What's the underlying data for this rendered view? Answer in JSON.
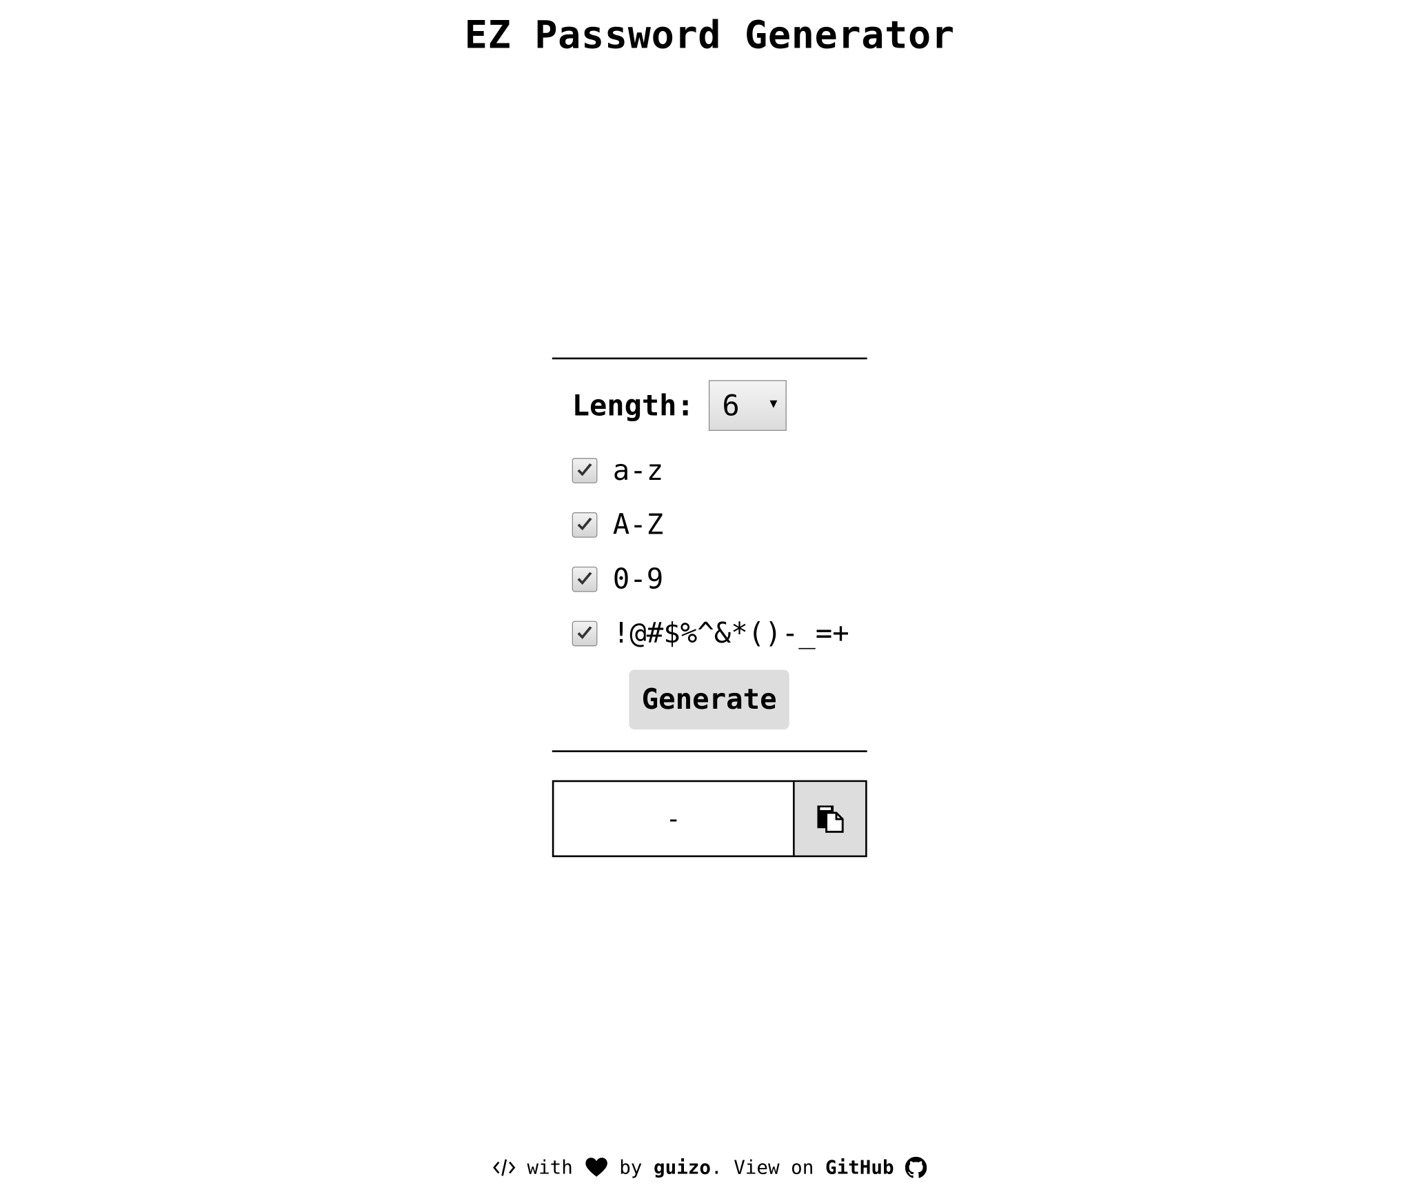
{
  "title": "EZ Password Generator",
  "length": {
    "label": "Length:",
    "selected": "6"
  },
  "options": [
    {
      "label": "a-z",
      "checked": true
    },
    {
      "label": "A-Z",
      "checked": true
    },
    {
      "label": "0-9",
      "checked": true
    },
    {
      "label": "!@#$%^&*()-_=+",
      "checked": true
    }
  ],
  "generate_label": "Generate",
  "output": {
    "value": "-"
  },
  "footer": {
    "code_icon": "code-icon",
    "with_text": " with ",
    "heart_icon": "heart-icon",
    "by_text": " by ",
    "author": "guizo",
    "view_text": ". View on ",
    "github_label": "GitHub",
    "github_icon": "github-icon"
  }
}
